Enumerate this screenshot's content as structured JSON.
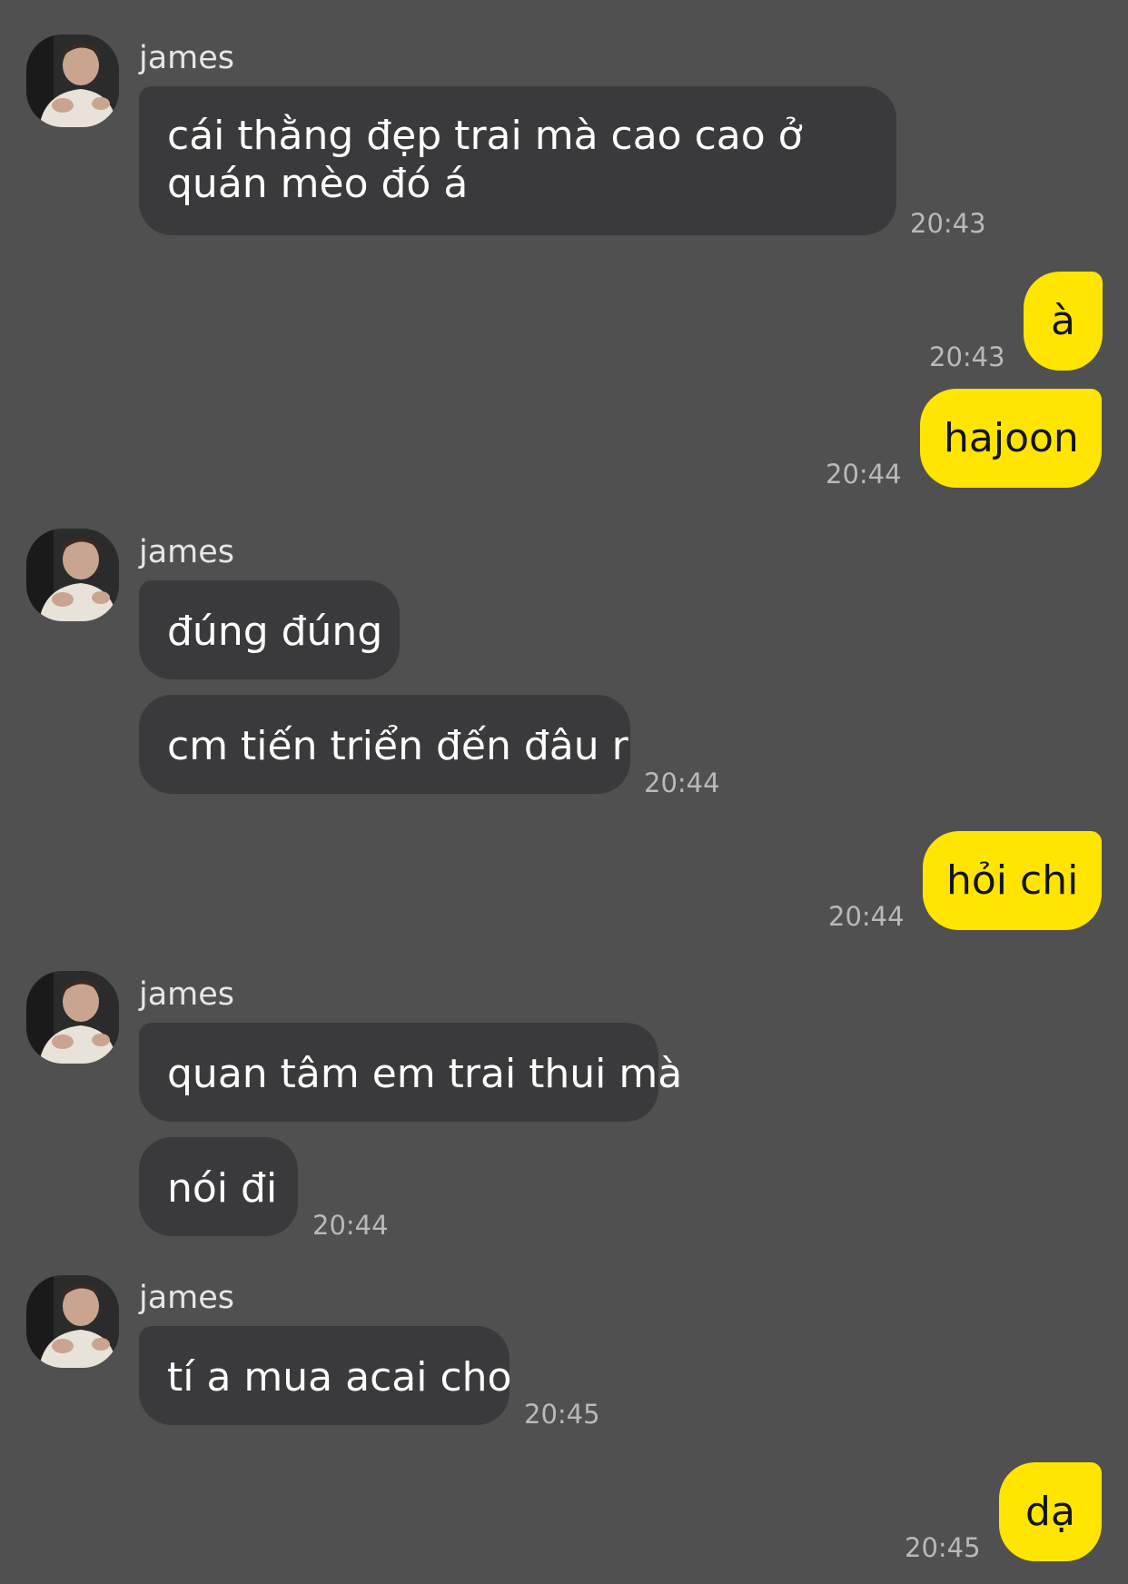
{
  "theme": {
    "background": "#505050",
    "incoming_bubble": "#3a3a3c",
    "outgoing_bubble": "#ffe500"
  },
  "messages": [
    {
      "sender": "james",
      "text": "cái thằng đẹp trai mà cao cao ở quán mèo đó á",
      "time": "20:43"
    },
    {
      "sender": "me",
      "text": "à",
      "time": "20:43"
    },
    {
      "sender": "me",
      "text": "hajoon",
      "time": "20:44"
    },
    {
      "sender": "james",
      "text": "đúng đúng"
    },
    {
      "sender": "james",
      "text": "cm tiến triển đến đâu r",
      "time": "20:44"
    },
    {
      "sender": "me",
      "text": "hỏi chi",
      "time": "20:44"
    },
    {
      "sender": "james",
      "text": "quan tâm em trai thui mà"
    },
    {
      "sender": "james",
      "text": "nói đi",
      "time": "20:44"
    },
    {
      "sender": "james",
      "text": "tí a mua acai cho",
      "time": "20:45"
    },
    {
      "sender": "me",
      "text": "dạ",
      "time": "20:45"
    }
  ],
  "sender_names": [
    "james",
    "james",
    "james",
    "james"
  ],
  "avatar_icon": "profile-photo"
}
